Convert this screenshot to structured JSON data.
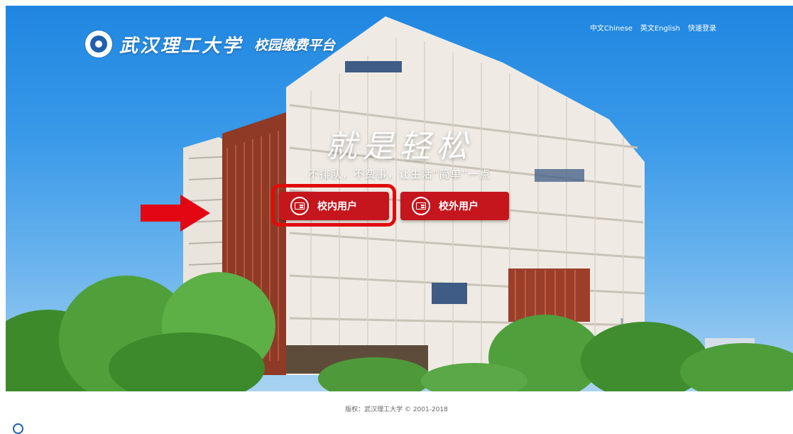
{
  "header": {
    "logo": {
      "emblem_icon": "university-emblem-icon",
      "school_name": "武汉理工大学",
      "platform_name": "校园缴费平台"
    },
    "nav": [
      {
        "label": "中文Chinese"
      },
      {
        "label": "英文English"
      },
      {
        "label": "快速登录"
      }
    ]
  },
  "hero": {
    "slogan": "就是轻松",
    "subslogan": "不排队，不费事，让生活“简单”一点"
  },
  "buttons": {
    "inner_user": {
      "label": "校内用户",
      "icon": "id-card-icon"
    },
    "outer_user": {
      "label": "校外用户",
      "icon": "id-card-icon"
    }
  },
  "annotation": {
    "arrow_icon": "red-arrow-right-icon",
    "highlight_color": "#e10b0b"
  },
  "footer": {
    "copyright": "版权：武汉理工大学 © 2001-2018"
  },
  "colors": {
    "brand_red": "#c4161c",
    "sky_blue": "#2f8fe4"
  }
}
